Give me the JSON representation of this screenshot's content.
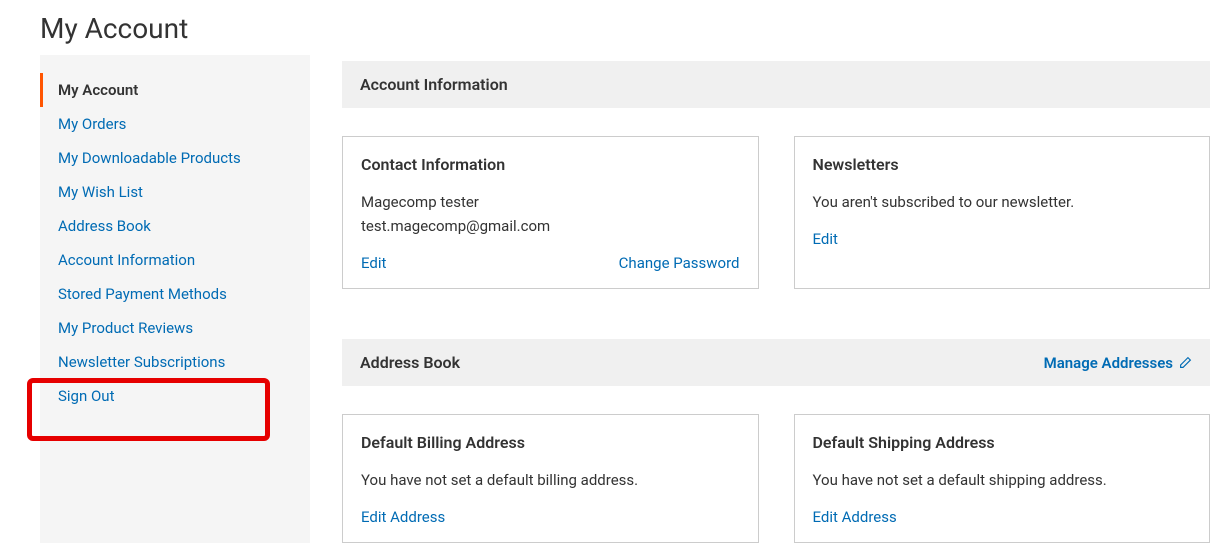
{
  "page": {
    "title": "My Account"
  },
  "sidebar": {
    "items": [
      {
        "label": "My Account",
        "active": true
      },
      {
        "label": "My Orders",
        "active": false
      },
      {
        "label": "My Downloadable Products",
        "active": false
      },
      {
        "label": "My Wish List",
        "active": false
      },
      {
        "label": "Address Book",
        "active": false
      },
      {
        "label": "Account Information",
        "active": false
      },
      {
        "label": "Stored Payment Methods",
        "active": false
      },
      {
        "label": "My Product Reviews",
        "active": false
      },
      {
        "label": "Newsletter Subscriptions",
        "active": false
      },
      {
        "label": "Sign Out",
        "active": false
      }
    ]
  },
  "account_info": {
    "header": "Account Information",
    "contact": {
      "title": "Contact Information",
      "name": "Magecomp tester",
      "email": "test.magecomp@gmail.com",
      "edit_label": "Edit",
      "change_password_label": "Change Password"
    },
    "newsletters": {
      "title": "Newsletters",
      "message": "You aren't subscribed to our newsletter.",
      "edit_label": "Edit"
    }
  },
  "address_book": {
    "header": "Address Book",
    "manage_label": "Manage Addresses",
    "billing": {
      "title": "Default Billing Address",
      "message": "You have not set a default billing address.",
      "edit_label": "Edit Address"
    },
    "shipping": {
      "title": "Default Shipping Address",
      "message": "You have not set a default shipping address.",
      "edit_label": "Edit Address"
    }
  }
}
